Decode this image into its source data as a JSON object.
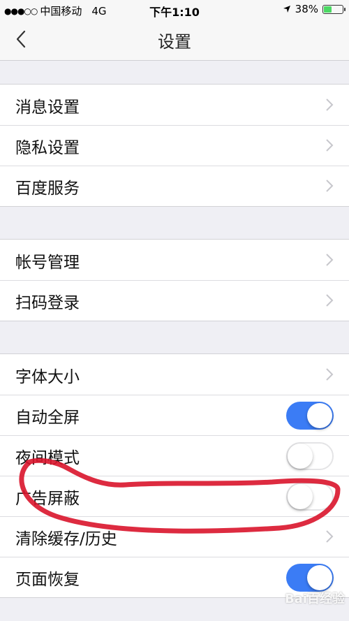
{
  "status_bar": {
    "signal_dots": "●●●○○",
    "carrier": "中国移动",
    "network": "4G",
    "time": "下午1:10",
    "location_icon": "location-arrow-icon",
    "battery_percent": "38%",
    "battery_level": 0.38,
    "battery_color": "#4cd964"
  },
  "navbar": {
    "back_icon": "chevron-left-icon",
    "title": "设置"
  },
  "groups": [
    {
      "items": [
        {
          "label": "消息设置",
          "control": "chevron"
        },
        {
          "label": "隐私设置",
          "control": "chevron"
        },
        {
          "label": "百度服务",
          "control": "chevron"
        }
      ]
    },
    {
      "items": [
        {
          "label": "帐号管理",
          "control": "chevron"
        },
        {
          "label": "扫码登录",
          "control": "chevron"
        }
      ]
    },
    {
      "items": [
        {
          "label": "字体大小",
          "control": "chevron"
        },
        {
          "label": "自动全屏",
          "control": "switch",
          "on": true
        },
        {
          "label": "夜间模式",
          "control": "switch",
          "on": false
        },
        {
          "label": "广告屏蔽",
          "control": "switch",
          "on": false
        },
        {
          "label": "清除缓存/历史",
          "control": "chevron"
        },
        {
          "label": "页面恢复",
          "control": "switch",
          "on": true
        }
      ]
    }
  ],
  "colors": {
    "switch_on": "#3b7cf5",
    "annotation": "#d9142b"
  },
  "watermark": "Bai百经验"
}
